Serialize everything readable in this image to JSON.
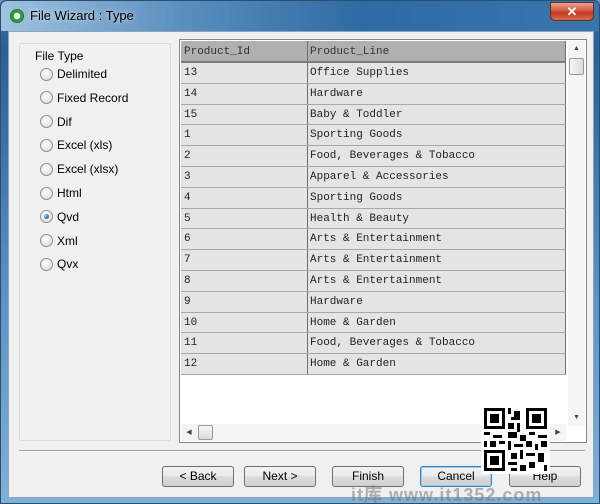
{
  "window": {
    "title": "File Wizard : Type",
    "close_glyph": "✕"
  },
  "file_type": {
    "label": "File Type",
    "options": [
      {
        "label": "Delimited",
        "checked": false
      },
      {
        "label": "Fixed Record",
        "checked": false
      },
      {
        "label": "Dif",
        "checked": false
      },
      {
        "label": "Excel (xls)",
        "checked": false
      },
      {
        "label": "Excel (xlsx)",
        "checked": false
      },
      {
        "label": "Html",
        "checked": false
      },
      {
        "label": "Qvd",
        "checked": true
      },
      {
        "label": "Xml",
        "checked": false
      },
      {
        "label": "Qvx",
        "checked": false
      }
    ]
  },
  "table": {
    "columns": [
      "Product_Id",
      "Product_Line"
    ],
    "rows": [
      [
        "13",
        "Office Supplies"
      ],
      [
        "14",
        "Hardware"
      ],
      [
        "15",
        "Baby & Toddler"
      ],
      [
        "1",
        "Sporting Goods"
      ],
      [
        "2",
        "Food, Beverages & Tobacco"
      ],
      [
        "3",
        "Apparel & Accessories"
      ],
      [
        "4",
        "Sporting Goods"
      ],
      [
        "5",
        "Health & Beauty"
      ],
      [
        "6",
        "Arts & Entertainment"
      ],
      [
        "7",
        "Arts & Entertainment"
      ],
      [
        "8",
        "Arts & Entertainment"
      ],
      [
        "9",
        "Hardware"
      ],
      [
        "10",
        "Home & Garden"
      ],
      [
        "11",
        "Food, Beverages & Tobacco"
      ],
      [
        "12",
        "Home & Garden"
      ]
    ],
    "scroll_glyphs": {
      "up": "▲",
      "down": "▼",
      "left": "◀",
      "right": "▶"
    }
  },
  "buttons": {
    "back": "< Back",
    "next": "Next >",
    "finish": "Finish",
    "cancel": "Cancel",
    "help": "Help"
  },
  "overlay": {
    "watermark": "it库 www.it1352.com"
  }
}
